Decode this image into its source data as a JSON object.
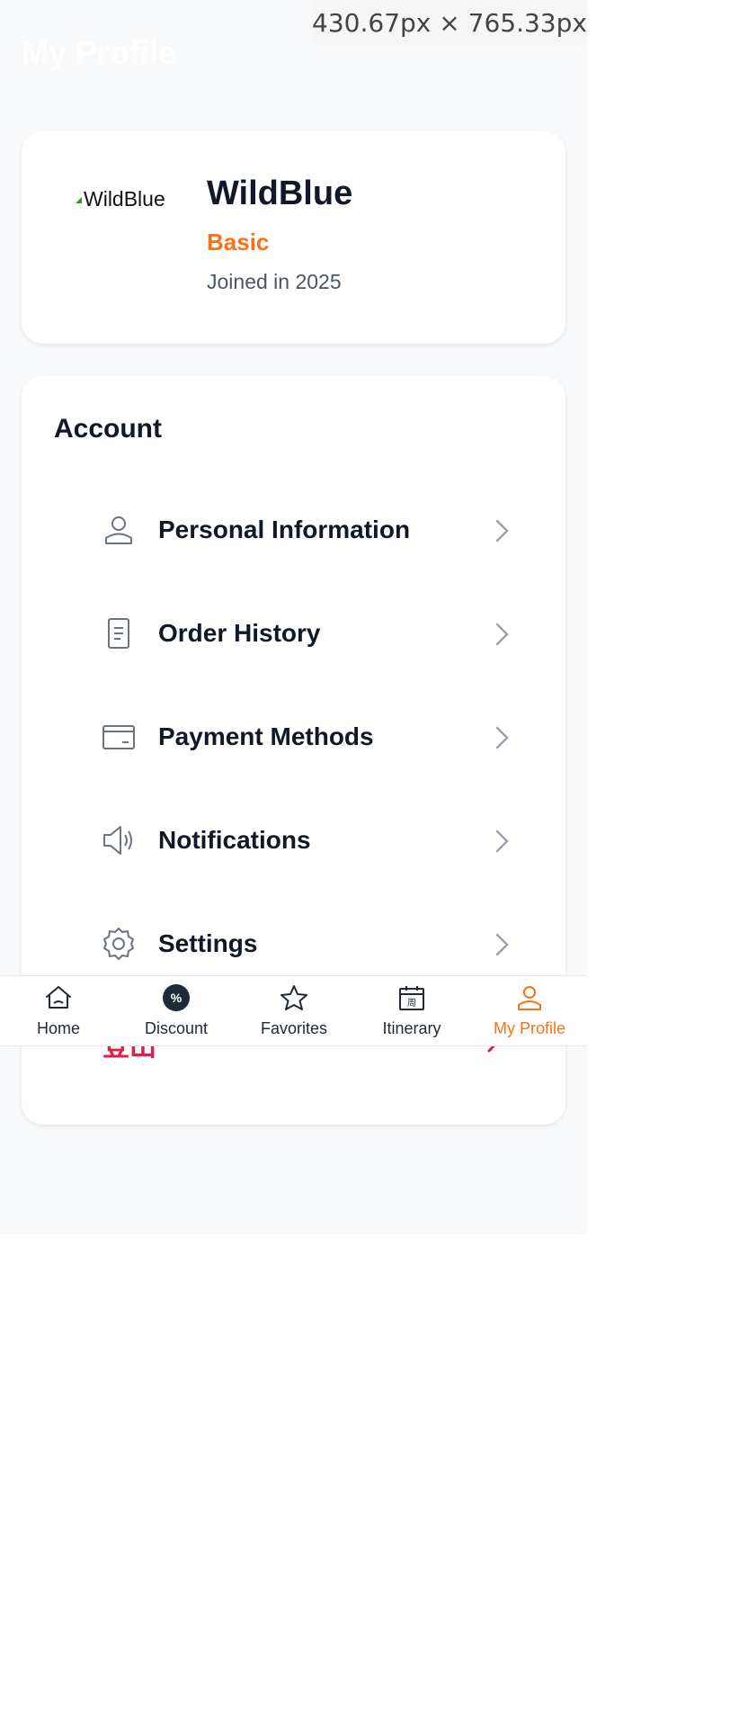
{
  "header": {
    "title": "My Profile"
  },
  "overlay": {
    "dimensions": "430.67px × 765.33px"
  },
  "profile": {
    "avatar_alt": "WildBlue",
    "name": "WildBlue",
    "tier": "Basic",
    "joined": "Joined in 2025"
  },
  "account": {
    "title": "Account",
    "items": [
      {
        "label": "Personal Information",
        "icon": "user-icon"
      },
      {
        "label": "Order History",
        "icon": "document-icon"
      },
      {
        "label": "Payment Methods",
        "icon": "wallet-icon"
      },
      {
        "label": "Notifications",
        "icon": "speaker-icon"
      },
      {
        "label": "Settings",
        "icon": "gear-icon"
      }
    ],
    "logout_label": "登出"
  },
  "tabbar": {
    "tabs": [
      {
        "label": "Home",
        "icon": "home-icon"
      },
      {
        "label": "Discount",
        "icon": "discount-icon",
        "badge": "%"
      },
      {
        "label": "Favorites",
        "icon": "star-icon"
      },
      {
        "label": "Itinerary",
        "icon": "calendar-icon",
        "badge": "周"
      },
      {
        "label": "My Profile",
        "icon": "profile-icon"
      }
    ],
    "active_index": 4
  },
  "colors": {
    "accent": "#f97316",
    "danger": "#e11d48",
    "text": "#111827",
    "icon": "#6b7280",
    "background": "#f8f9fa"
  }
}
